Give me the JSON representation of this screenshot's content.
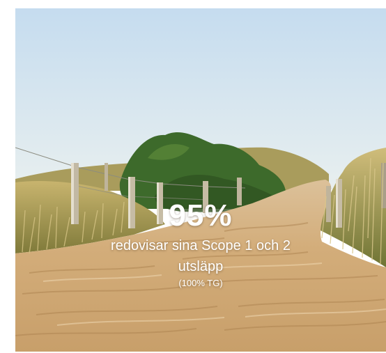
{
  "stat": {
    "value": "95%",
    "description_line1": "redovisar sina Scope 1 och 2",
    "description_line2": "utsläpp",
    "note": "(100% TG)"
  },
  "colors": {
    "sky_top": "#c9dff0",
    "sky_bottom": "#e6eef0",
    "sand": "#d7b382",
    "sand_dark": "#b98e5a",
    "vegetation": "#3f6b2a",
    "grass": "#b9a566",
    "text": "#ffffff"
  }
}
